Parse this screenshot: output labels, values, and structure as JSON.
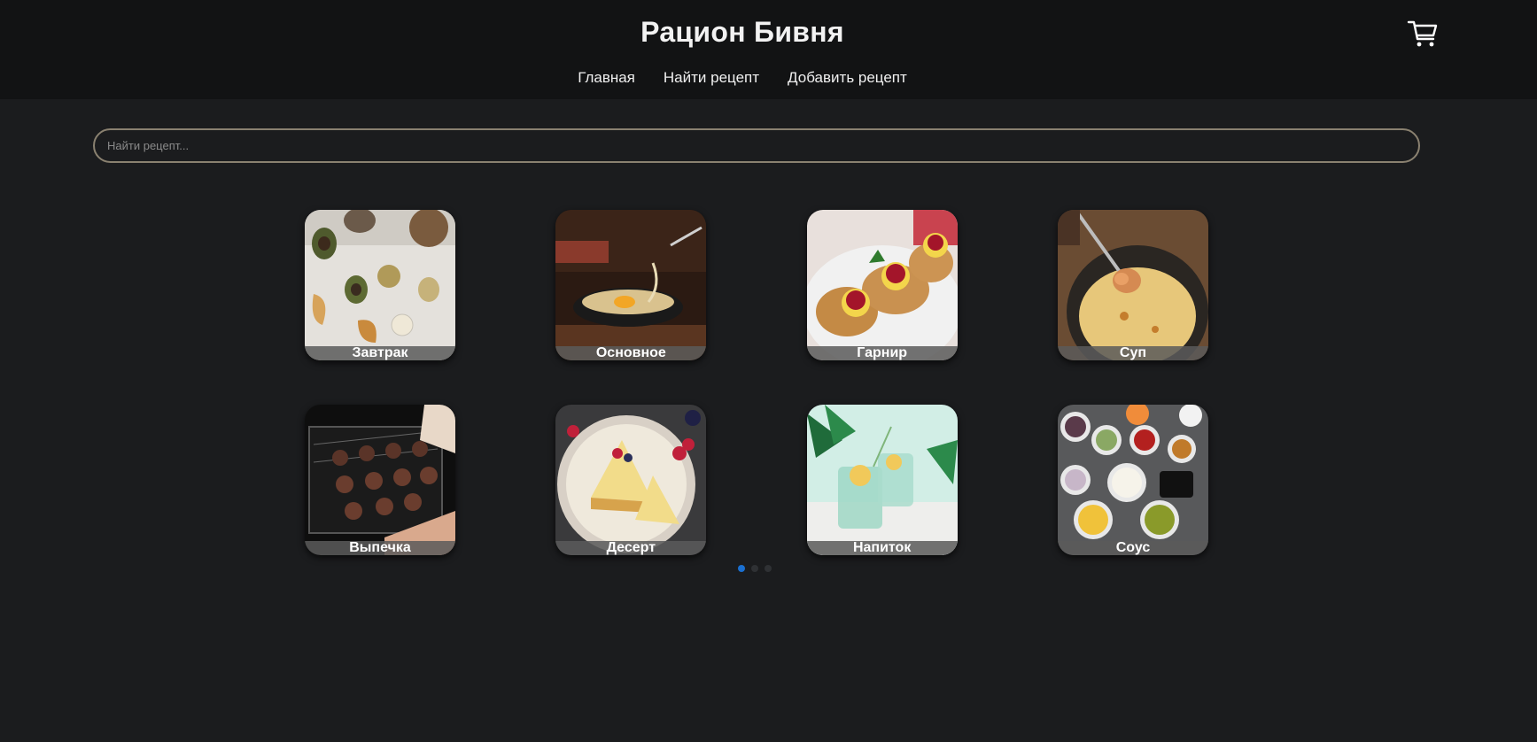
{
  "header": {
    "title": "Рацион Бивня",
    "nav": [
      {
        "label": "Главная"
      },
      {
        "label": "Найти рецепт"
      },
      {
        "label": "Добавить рецепт"
      }
    ],
    "cart_icon": "cart-icon"
  },
  "search": {
    "placeholder": "Найти рецепт..."
  },
  "categories": [
    {
      "label": "Завтрак"
    },
    {
      "label": "Основное"
    },
    {
      "label": "Гарнир"
    },
    {
      "label": "Суп"
    },
    {
      "label": "Выпечка"
    },
    {
      "label": "Десерт"
    },
    {
      "label": "Напиток"
    },
    {
      "label": "Соус"
    }
  ],
  "carousel": {
    "pages": 3,
    "active": 1
  },
  "colors": {
    "background": "#1b1c1e",
    "header": "#121314",
    "search_border": "#8a8170",
    "active_dot": "#1a6fd0"
  }
}
